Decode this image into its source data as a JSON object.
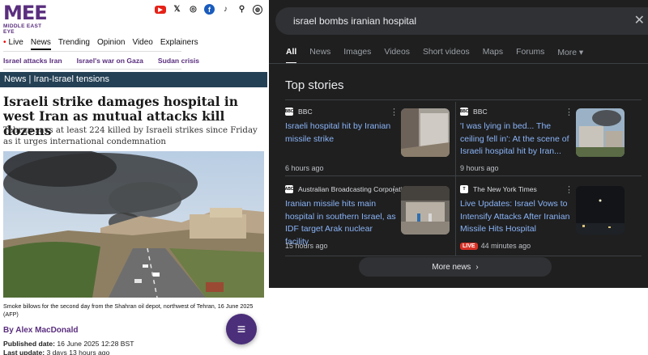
{
  "mee": {
    "logo": {
      "mark": "MEE",
      "sub": "MIDDLE EAST EYE"
    },
    "social": [
      {
        "name": "youtube",
        "glyph": "▶"
      },
      {
        "name": "x",
        "glyph": "𝕏"
      },
      {
        "name": "instagram",
        "glyph": "◎"
      },
      {
        "name": "facebook",
        "glyph": "f"
      },
      {
        "name": "tiktok",
        "glyph": "♪"
      },
      {
        "name": "search",
        "glyph": "⚲"
      },
      {
        "name": "language",
        "glyph": "◍"
      }
    ],
    "nav": {
      "live": "Live",
      "news": "News",
      "trending": "Trending",
      "opinion": "Opinion",
      "video": "Video",
      "explainers": "Explainers"
    },
    "topics": [
      "Israel attacks Iran",
      "Israel's war on Gaza",
      "Sudan crisis"
    ],
    "band": "News | Iran-Israel tensions",
    "headline": "Israeli strike damages hospital in west Iran as mutual attacks kill dozens",
    "subhead": "Tehran says at least 224 killed by Israeli strikes since Friday as it urges international condemnation",
    "caption": "Smoke billows for the second day from the Shahran oil depot, northwest of Tehran, 16 June 2025 (AFP)",
    "author_prefix": "By",
    "author": "Alex MacDonald",
    "published_label": "Published date:",
    "published": "16 June 2025 12:28 BST",
    "updated_label": "Last update:",
    "updated": "3 days 13 hours ago",
    "fab_glyph": "≡"
  },
  "google": {
    "query": "israel bombs iranian hospital",
    "close_glyph": "✕",
    "tabs": [
      "All",
      "News",
      "Images",
      "Videos",
      "Short videos",
      "Maps",
      "Forums",
      "More ▾"
    ],
    "section_title": "Top stories",
    "stories": [
      {
        "source": "BBC",
        "source_icon": "BBC",
        "title": "Israeli hospital hit by Iranian missile strike",
        "time": "6 hours ago",
        "live": ""
      },
      {
        "source": "BBC",
        "source_icon": "BBC",
        "title": "'I was lying in bed... The ceiling fell in': At the scene of Israeli hospital hit by Iran...",
        "time": "9 hours ago",
        "live": ""
      },
      {
        "source": "Australian Broadcasting Corporation",
        "source_icon": "ABC",
        "title": "Iranian missile hits main hospital in southern Israel, as IDF target Arak nuclear facility",
        "time": "15 hours ago",
        "live": ""
      },
      {
        "source": "The New York Times",
        "source_icon": "T",
        "title": "Live Updates: Israel Vows to Intensify Attacks After Iranian Missile Hits Hospital",
        "time": "44 minutes ago",
        "live": "LIVE"
      }
    ],
    "more_news": "More news",
    "more_news_arrow": "›"
  }
}
